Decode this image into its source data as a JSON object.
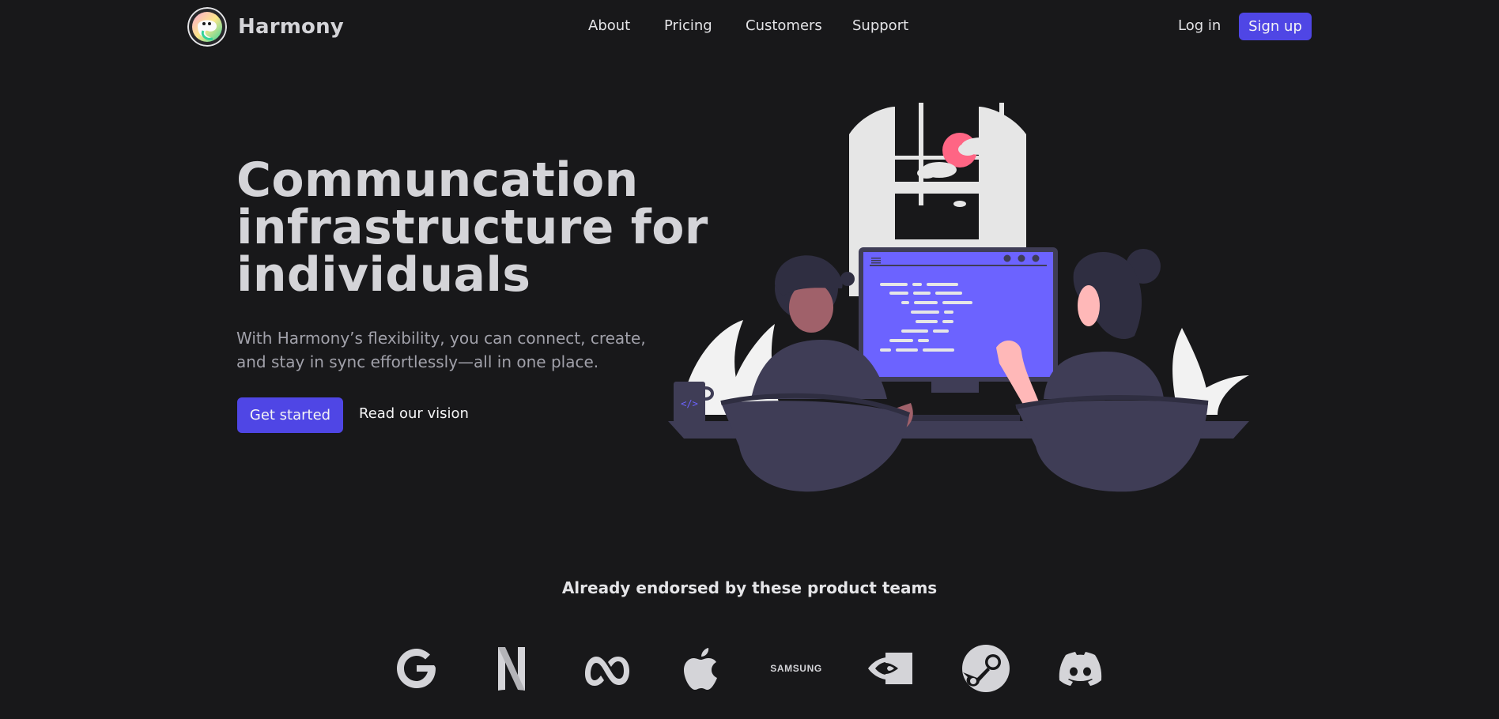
{
  "brand": {
    "name": "Harmony",
    "logo_icon": "harmony-logo-icon"
  },
  "nav": {
    "items": [
      {
        "label": "About"
      },
      {
        "label": "Pricing"
      },
      {
        "label": "Customers"
      },
      {
        "label": "Support"
      }
    ]
  },
  "auth": {
    "login_label": "Log in",
    "signup_label": "Sign up"
  },
  "hero": {
    "title_lines": [
      "Communcation",
      "infrastructure for",
      "individuals"
    ],
    "subtitle": "With Harmony’s flexibility, you can connect, create, and stay in sync effortlessly—all in one place.",
    "primary_cta": "Get started",
    "secondary_cta": "Read our vision",
    "illustration_icon": "two-developers-at-computer-illustration",
    "mug_label": "</>"
  },
  "endorsements": {
    "title": "Already endorsed by these product teams",
    "logos": [
      {
        "icon": "google-logo-icon"
      },
      {
        "icon": "netflix-logo-icon"
      },
      {
        "icon": "meta-logo-icon"
      },
      {
        "icon": "apple-logo-icon"
      },
      {
        "icon": "samsung-logo-icon",
        "text": "SAMSUNG"
      },
      {
        "icon": "nvidia-logo-icon"
      },
      {
        "icon": "steam-logo-icon"
      },
      {
        "icon": "discord-logo-icon"
      }
    ]
  },
  "colors": {
    "background": "#18181a",
    "accent": "#4f46e5",
    "screen": "#6c63ff",
    "text_muted": "#a1a1aa",
    "heading": "#d4d4d8",
    "figure": "#3f3d56"
  }
}
